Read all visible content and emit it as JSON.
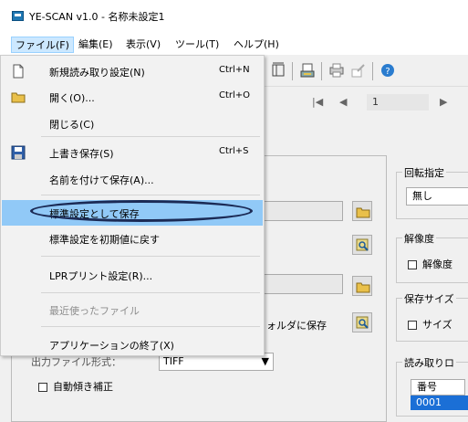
{
  "window": {
    "title": "YE-SCAN v1.0 - 名称未設定1"
  },
  "menubar": {
    "items": [
      "ファイル(F)",
      "編集(E)",
      "表示(V)",
      "ツール(T)",
      "ヘルプ(H)"
    ]
  },
  "file_menu": {
    "new_scan": {
      "label": "新規読み取り設定(N)",
      "shortcut": "Ctrl+N"
    },
    "open": {
      "label": "開く(O)...",
      "shortcut": "Ctrl+O"
    },
    "close": {
      "label": "閉じる(C)"
    },
    "save": {
      "label": "上書き保存(S)",
      "shortcut": "Ctrl+S"
    },
    "save_as": {
      "label": "名前を付けて保存(A)..."
    },
    "save_default": {
      "label": "標準設定として保存"
    },
    "reset_default": {
      "label": "標準設定を初期値に戻す"
    },
    "lpr_settings": {
      "label": "LPRプリント設定(R)..."
    },
    "recent_files": {
      "label": "最近使ったファイル"
    },
    "exit": {
      "label": "アプリケーションの終了(X)"
    }
  },
  "navbar": {
    "page_number": "1"
  },
  "form": {
    "folder_save_label": "ォルダに保存",
    "output_format_label": "出力ファイル形式：",
    "output_format_value": "TIFF",
    "auto_deskew_label": "自動傾き補正"
  },
  "right_panel": {
    "rotation": {
      "label": "回転指定",
      "value": "無し"
    },
    "resolution": {
      "label": "解像度",
      "checkbox_label": "解像度"
    },
    "save_size": {
      "label": "保存サイズ",
      "checkbox_label": "サイズ"
    },
    "read_order": {
      "label": "読み取りロ",
      "column_header": "番号",
      "row_value": "0001"
    }
  },
  "colors": {
    "highlight": "#91c9f7",
    "ellipse": "#1b2a55",
    "menu_active": "#cce8ff"
  }
}
